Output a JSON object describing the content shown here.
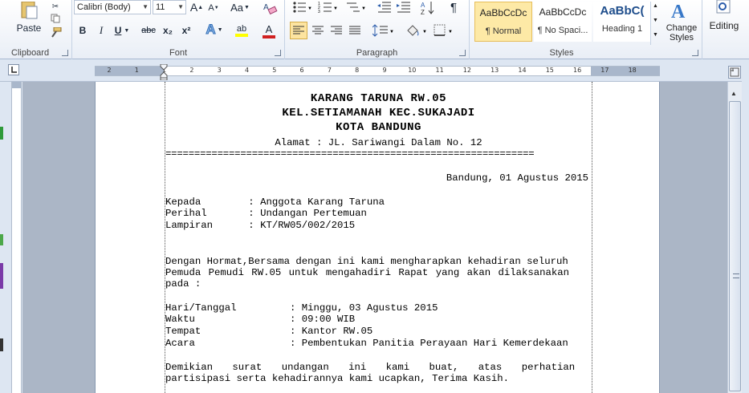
{
  "ribbon": {
    "clipboard": {
      "label": "Clipboard",
      "paste_label": "Paste"
    },
    "font": {
      "label": "Font",
      "font_name": "Calibri (Body)",
      "font_size": "11",
      "grow": "A",
      "shrink": "A",
      "change_case": "Aa",
      "bold": "B",
      "italic": "I",
      "underline": "U",
      "strike": "abc",
      "subscript": "x₂",
      "superscript": "x²",
      "text_effects": "A",
      "highlight": "ab",
      "font_color": "A"
    },
    "paragraph": {
      "label": "Paragraph"
    },
    "styles": {
      "label": "Styles",
      "items": [
        {
          "sample": "AaBbCcDc",
          "name": "¶ Normal"
        },
        {
          "sample": "AaBbCcDc",
          "name": "¶ No Spaci..."
        },
        {
          "sample": "AaBbC(",
          "name": "Heading 1"
        }
      ],
      "change_styles_label_1": "Change",
      "change_styles_label_2": "Styles"
    },
    "editing": {
      "label": "Editing"
    }
  },
  "ruler": {
    "ticks": [
      "2",
      "1",
      "1",
      "2",
      "3",
      "4",
      "5",
      "6",
      "7",
      "8",
      "9",
      "10",
      "11",
      "12",
      "13",
      "14",
      "15",
      "16",
      "17",
      "18"
    ]
  },
  "document": {
    "heading1": "KARANG TARUNA RW.05",
    "heading2": "KEL.SETIAMANAH KEC.SUKAJADI",
    "heading3": "KOTA BANDUNG",
    "address": "Alamat : JL. Sariwangi Dalam No. 12",
    "separator": "================================================================",
    "date_line": "Bandung, 01 Agustus 2015",
    "kepada": "Kepada        : Anggota Karang Taruna",
    "perihal": "Perihal       : Undangan Pertemuan",
    "lampiran": "Lampiran      : KT/RW05/002/2015",
    "body1": "Dengan Hormat,Bersama dengan ini kami mengharapkan kehadiran seluruh",
    "body2": "Pemuda Pemudi RW.05 untuk mengahadiri Rapat yang akan dilaksanakan",
    "body3": "pada :",
    "hari": "Hari/Tanggal         : Minggu, 03 Agustus 2015",
    "waktu": "Waktu                : 09:00 WIB",
    "tempat": "Tempat               : Kantor RW.05",
    "acara": "Acara                : Pembentukan Panitia Perayaan Hari Kemerdekaan",
    "closing1": "Demikian surat undangan ini kami buat, atas perhatian dan",
    "closing2": "partisipasi serta kehadirannya kami ucapkan, Terima Kasih."
  },
  "colors": {
    "ribbon_bg": "#e9eef6",
    "workspace": "#abb6c6",
    "selected_style": "#fde9a6",
    "heading_style": "#1f4e8c"
  }
}
